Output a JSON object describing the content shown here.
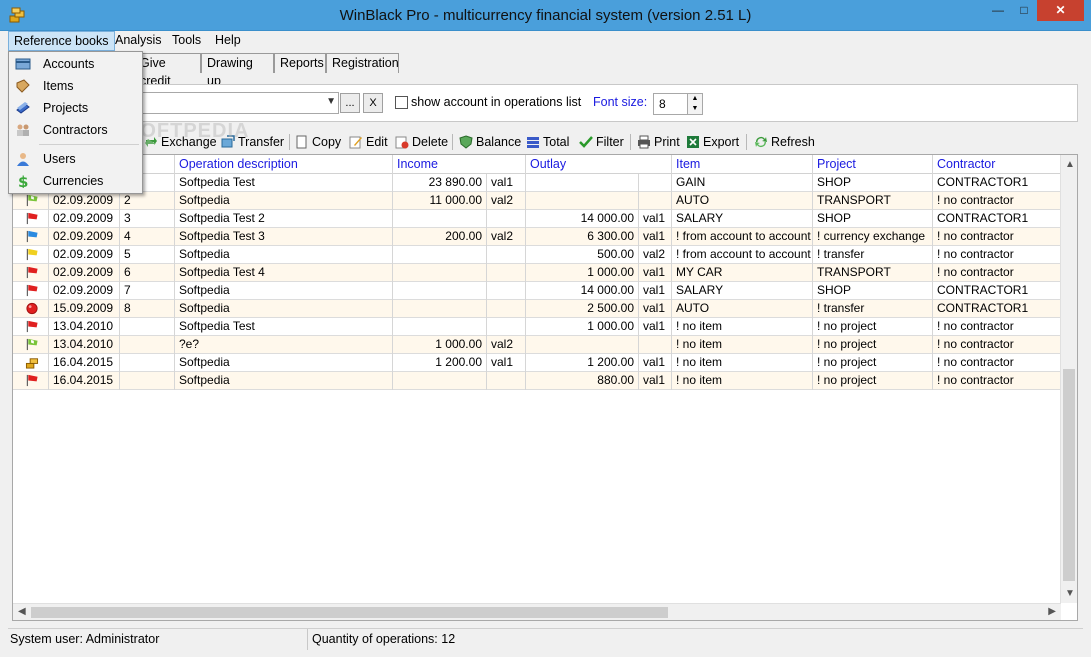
{
  "window": {
    "title": "WinBlack Pro - multicurrency financial system (version 2.51 L)"
  },
  "menu": {
    "items": [
      "Reference books",
      "Analysis",
      "Tools",
      "Help"
    ]
  },
  "dropdown": {
    "items": [
      "Accounts",
      "Items",
      "Projects",
      "Contractors",
      "Users",
      "Currencies"
    ]
  },
  "tabs": [
    "Give credit",
    "Drawing up",
    "Reports",
    "Registration"
  ],
  "filter": {
    "browse_label": "...",
    "clear_label": "X",
    "checkbox_label": "show account in operations list",
    "font_size_label": "Font size:",
    "font_size_value": "8"
  },
  "toolbar": {
    "exchange": "Exchange",
    "transfer": "Transfer",
    "copy": "Copy",
    "edit": "Edit",
    "delete": "Delete",
    "balance": "Balance",
    "total": "Total",
    "filter": "Filter",
    "print": "Print",
    "export": "Export",
    "refresh": "Refresh"
  },
  "table": {
    "headers": [
      "Operation description",
      "Income",
      "Outlay",
      "Item",
      "Project",
      "Contractor"
    ],
    "rows": [
      {
        "flag": "red",
        "date": "",
        "num": "",
        "desc": "Softpedia Test",
        "income": "23 890.00",
        "income_cur": "val1",
        "outlay": "",
        "outlay_cur": "",
        "item": "GAIN",
        "project": "SHOP",
        "contractor": "CONTRACTOR1"
      },
      {
        "flag": "green",
        "date": "02.09.2009",
        "num": "2",
        "desc": "Softpedia",
        "income": "11 000.00",
        "income_cur": "val2",
        "outlay": "",
        "outlay_cur": "",
        "item": "AUTO",
        "project": "TRANSPORT",
        "contractor": "! no contractor"
      },
      {
        "flag": "red",
        "date": "02.09.2009",
        "num": "3",
        "desc": "Softpedia Test 2",
        "income": "",
        "income_cur": "",
        "outlay": "14 000.00",
        "outlay_cur": "val1",
        "item": "SALARY",
        "project": "SHOP",
        "contractor": "CONTRACTOR1"
      },
      {
        "flag": "blue",
        "date": "02.09.2009",
        "num": "4",
        "desc": "Softpedia Test 3",
        "income": "200.00",
        "income_cur": "val2",
        "outlay": "6 300.00",
        "outlay_cur": "val1",
        "item": "! from account to account",
        "project": "! currency exchange",
        "contractor": "! no contractor"
      },
      {
        "flag": "yellow",
        "date": "02.09.2009",
        "num": "5",
        "desc": "Softpedia",
        "income": "",
        "income_cur": "",
        "outlay": "500.00",
        "outlay_cur": "val2",
        "item": "! from account to account",
        "project": "! transfer",
        "contractor": "! no contractor"
      },
      {
        "flag": "red",
        "date": "02.09.2009",
        "num": "6",
        "desc": "Softpedia Test 4",
        "income": "",
        "income_cur": "",
        "outlay": "1 000.00",
        "outlay_cur": "val1",
        "item": "MY CAR",
        "project": "TRANSPORT",
        "contractor": "! no contractor"
      },
      {
        "flag": "red",
        "date": "02.09.2009",
        "num": "7",
        "desc": "Softpedia",
        "income": "",
        "income_cur": "",
        "outlay": "14 000.00",
        "outlay_cur": "val1",
        "item": "SALARY",
        "project": "SHOP",
        "contractor": "CONTRACTOR1"
      },
      {
        "flag": "circle",
        "date": "15.09.2009",
        "num": "8",
        "desc": "Softpedia",
        "income": "",
        "income_cur": "",
        "outlay": "2 500.00",
        "outlay_cur": "val1",
        "item": "AUTO",
        "project": "! transfer",
        "contractor": "CONTRACTOR1"
      },
      {
        "flag": "red",
        "date": "13.04.2010",
        "num": "",
        "desc": "Softpedia Test",
        "income": "",
        "income_cur": "",
        "outlay": "1 000.00",
        "outlay_cur": "val1",
        "item": "! no item",
        "project": "! no project",
        "contractor": "! no contractor"
      },
      {
        "flag": "green",
        "date": "13.04.2010",
        "num": "",
        "desc": "?e?",
        "income": "1 000.00",
        "income_cur": "val2",
        "outlay": "",
        "outlay_cur": "",
        "item": "! no item",
        "project": "! no project",
        "contractor": "! no contractor"
      },
      {
        "flag": "coins",
        "date": "16.04.2015",
        "num": "",
        "desc": "Softpedia",
        "income": "1 200.00",
        "income_cur": "val1",
        "outlay": "1 200.00",
        "outlay_cur": "val1",
        "item": "! no item",
        "project": "! no project",
        "contractor": "! no contractor"
      },
      {
        "flag": "red",
        "date": "16.04.2015",
        "num": "",
        "desc": "Softpedia",
        "income": "",
        "income_cur": "",
        "outlay": "880.00",
        "outlay_cur": "val1",
        "item": "! no item",
        "project": "! no project",
        "contractor": "! no contractor"
      }
    ]
  },
  "status": {
    "user": "System user: Administrator",
    "quantity": "Quantity of operations: 12"
  },
  "watermark": "SOFTPEDIA",
  "colors": {
    "titlebar": "#4a9fdb",
    "header_text": "#1a1ae0",
    "alt_row": "#fff8ec",
    "close": "#c7412f"
  }
}
